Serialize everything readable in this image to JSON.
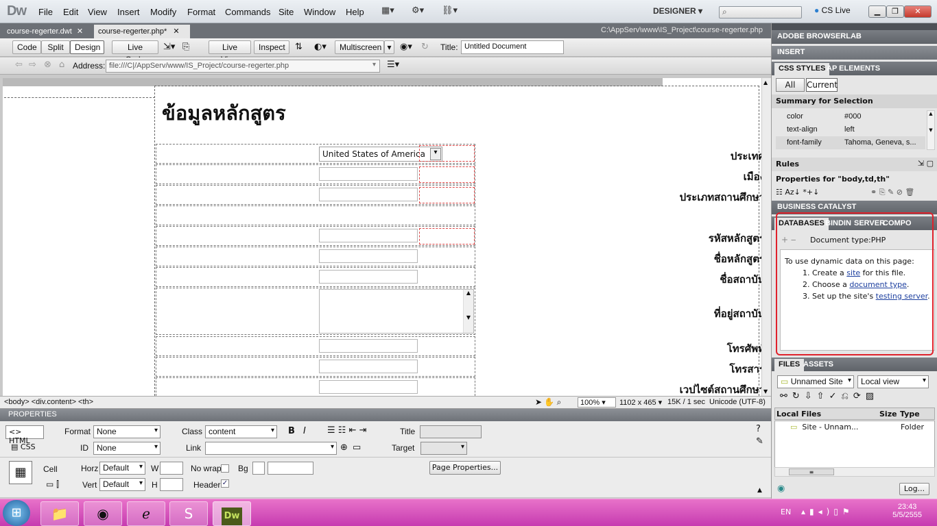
{
  "app": {
    "logo": "Dw",
    "workspace": "DESIGNER",
    "cs_live": "CS Live"
  },
  "menu": [
    "File",
    "Edit",
    "View",
    "Insert",
    "Modify",
    "Format",
    "Commands",
    "Site",
    "Window",
    "Help"
  ],
  "doc_tabs": [
    {
      "label": "course-regerter.dwt",
      "active": false
    },
    {
      "label": "course-regerter.php*",
      "active": true
    }
  ],
  "file_path": "C:\\AppServ\\www\\IS_Project\\course-regerter.php",
  "toolbar": {
    "code": "Code",
    "split": "Split",
    "design": "Design",
    "live_code": "Live Code",
    "live_view": "Live View",
    "inspect": "Inspect",
    "multiscreen": "Multiscreen",
    "title_label": "Title:",
    "title_value": "Untitled Document"
  },
  "address": {
    "label": "Address:",
    "value": "file:///C|/AppServ/www/IS_Project/course-regerter.php"
  },
  "page": {
    "heading": "ข้อมูลหลักสูตร",
    "country_value": "United States of America",
    "labels": [
      "ประเทศ",
      "เมือง",
      "ประเภทสถานศึกษา",
      "",
      "รหัสหลักสูตร",
      "ชื่อหลักสูตร",
      "ชื่อสถาบัน",
      "ที่อยู่สถาบัน",
      "โทรศัพท์",
      "โทรสาร",
      "เวปไซต์สถานศึกษา"
    ]
  },
  "status": {
    "tags": "<body> <div.content> <th>",
    "zoom": "100%",
    "size": "1102 x 465",
    "download": "15K / 1 sec",
    "encoding": "Unicode (UTF-8)"
  },
  "properties": {
    "title": "PROPERTIES",
    "html_btn": "HTML",
    "css_btn": "CSS",
    "format_label": "Format",
    "format_value": "None",
    "class_label": "Class",
    "class_value": "content",
    "id_label": "ID",
    "id_value": "None",
    "link_label": "Link",
    "title_label": "Title",
    "target_label": "Target",
    "cell_label": "Cell",
    "horz_label": "Horz",
    "horz_value": "Default",
    "vert_label": "Vert",
    "vert_value": "Default",
    "w_label": "W",
    "h_label": "H",
    "nowrap_label": "No wrap",
    "bg_label": "Bg",
    "header_label": "Header",
    "page_props": "Page Properties..."
  },
  "panels": {
    "browserlab": "ADOBE BROWSERLAB",
    "insert": "INSERT",
    "css_tabs": [
      "CSS STYLES",
      "AP ELEMENTS"
    ],
    "all": "All",
    "current": "Current",
    "summary": "Summary for Selection",
    "css_props": [
      {
        "name": "color",
        "value": "#000"
      },
      {
        "name": "text-align",
        "value": "left"
      },
      {
        "name": "font-family",
        "value": "Tahoma, Geneva, s..."
      }
    ],
    "rules": "Rules",
    "props_for": "Properties for \"body,td,th\"",
    "business_catalyst": "BUSINESS CATALYST",
    "db_tabs": [
      "DATABASES",
      "BINDIN",
      "SERVER",
      "COMPO"
    ],
    "doc_type": "Document type:PHP",
    "intro": "To use dynamic data on this page:",
    "step1_pre": "1.  Create a ",
    "step1_link": "site",
    "step1_post": " for this file.",
    "step2_pre": "2.  Choose a ",
    "step2_link": "document type",
    "step2_post": ".",
    "step3_pre": "3.  Set up the site's ",
    "step3_link": "testing server",
    "step3_post": ".",
    "files_tabs": [
      "FILES",
      "ASSETS"
    ],
    "site_select": "Unnamed Site",
    "view_select": "Local view",
    "files_cols": [
      "Local Files",
      "Size",
      "Type"
    ],
    "files_row": {
      "name": "Site - Unnam...",
      "type": "Folder"
    },
    "log": "Log..."
  },
  "taskbar": {
    "lang": "EN",
    "time": "23:43",
    "date": "5/5/2555"
  },
  "colors": {
    "highlight": "#e0212b",
    "taskbar": "#d650bd"
  }
}
